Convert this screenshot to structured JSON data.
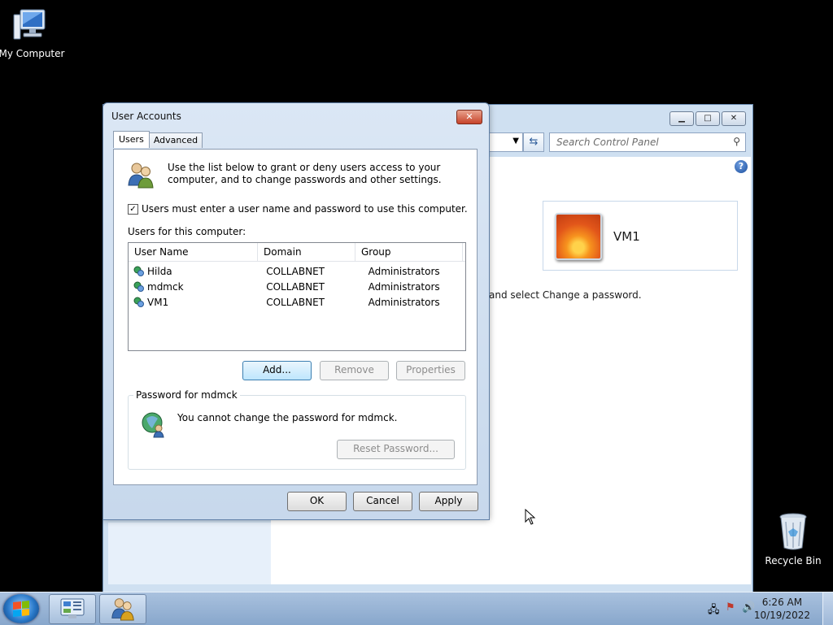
{
  "desktop": {
    "my_computer_label": "My Computer",
    "recycle_bin_label": "Recycle Bin"
  },
  "control_panel": {
    "search_placeholder": "Search Control Panel",
    "account_name": "VM1",
    "instruction_fragment": "and select Change a password."
  },
  "dialog": {
    "title": "User Accounts",
    "tabs": [
      "Users",
      "Advanced"
    ],
    "active_tab": "Users",
    "intro_text": "Use the list below to grant or deny users access to your computer, and to change passwords and other settings.",
    "require_login_label": "Users must enter a user name and password to use this computer.",
    "require_login_checked": true,
    "users_label": "Users for this computer:",
    "columns": [
      "User Name",
      "Domain",
      "Group"
    ],
    "users": [
      {
        "name": "Hilda",
        "domain": "COLLABNET",
        "group": "Administrators"
      },
      {
        "name": "mdmck",
        "domain": "COLLABNET",
        "group": "Administrators"
      },
      {
        "name": "VM1",
        "domain": "COLLABNET",
        "group": "Administrators"
      }
    ],
    "buttons": {
      "add": "Add...",
      "remove": "Remove",
      "properties": "Properties"
    },
    "password_group_title": "Password for mdmck",
    "password_message": "You cannot change the password for mdmck.",
    "reset_password_label": "Reset Password...",
    "footer": {
      "ok": "OK",
      "cancel": "Cancel",
      "apply": "Apply"
    }
  },
  "taskbar": {
    "time": "6:26 AM",
    "date": "10/19/2022"
  }
}
